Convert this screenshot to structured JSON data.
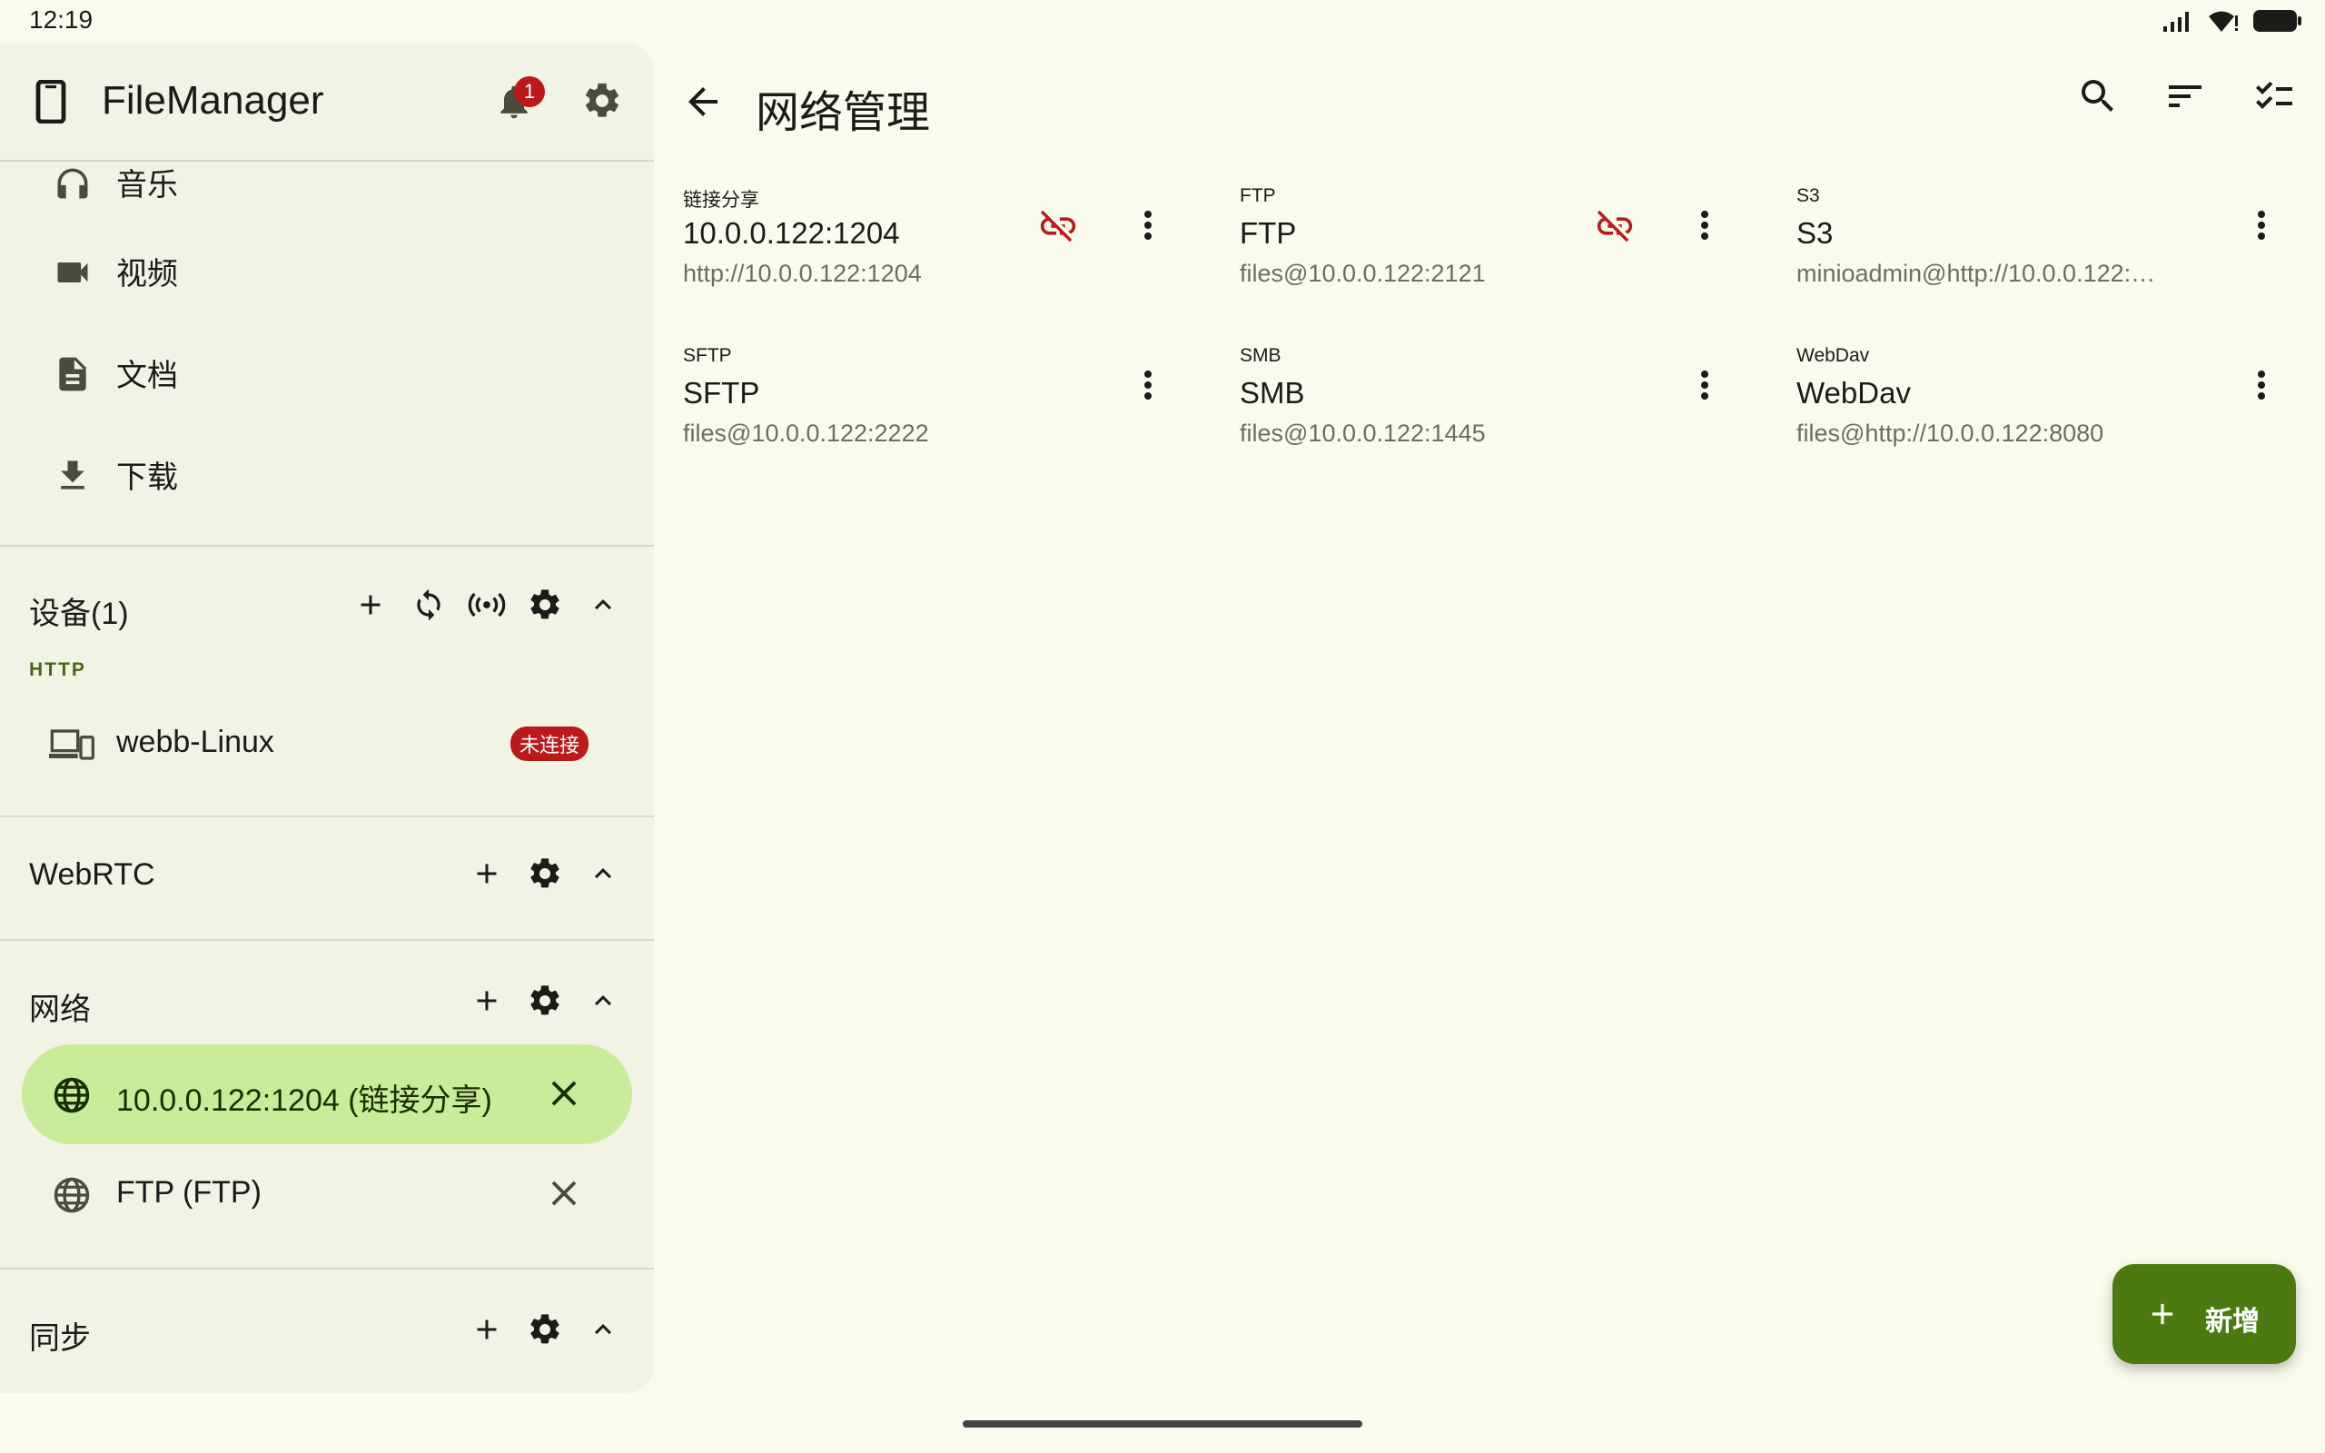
{
  "status": {
    "time": "12:19"
  },
  "sidebar": {
    "app_title": "FileManager",
    "notification_count": "1",
    "nav_items": [
      {
        "label": "音乐",
        "icon": "headphones-icon"
      },
      {
        "label": "视频",
        "icon": "videocam-icon"
      },
      {
        "label": "文档",
        "icon": "document-icon"
      },
      {
        "label": "下载",
        "icon": "download-icon"
      }
    ],
    "devices": {
      "title": "设备(1)",
      "group_label": "HTTP",
      "items": [
        {
          "label": "webb-Linux",
          "badge": "未连接"
        }
      ]
    },
    "webrtc": {
      "title": "WebRTC"
    },
    "network": {
      "title": "网络",
      "items": [
        {
          "label": "10.0.0.122:1204 (链接分享)",
          "active": true
        },
        {
          "label": "FTP (FTP)",
          "active": false
        }
      ]
    },
    "sync": {
      "title": "同步"
    }
  },
  "main": {
    "title": "网络管理",
    "cards": [
      {
        "type": "链接分享",
        "name": "10.0.0.122:1204",
        "address": "http://10.0.0.122:1204",
        "disconnected_icon": true
      },
      {
        "type": "FTP",
        "name": "FTP",
        "address": "files@10.0.0.122:2121",
        "disconnected_icon": true
      },
      {
        "type": "S3",
        "name": "S3",
        "address": "minioadmin@http://10.0.0.122:…",
        "disconnected_icon": false
      },
      {
        "type": "SFTP",
        "name": "SFTP",
        "address": "files@10.0.0.122:2222",
        "disconnected_icon": false
      },
      {
        "type": "SMB",
        "name": "SMB",
        "address": "files@10.0.0.122:1445",
        "disconnected_icon": false
      },
      {
        "type": "WebDav",
        "name": "WebDav",
        "address": "files@http://10.0.0.122:8080",
        "disconnected_icon": false
      }
    ],
    "fab_label": "新增"
  },
  "colors": {
    "accent": "#4c7a10",
    "active_bg": "#c9ec9a",
    "error": "#ba1a1a",
    "background": "#f9fbec",
    "sidebar_bg": "#f1f3e4"
  }
}
